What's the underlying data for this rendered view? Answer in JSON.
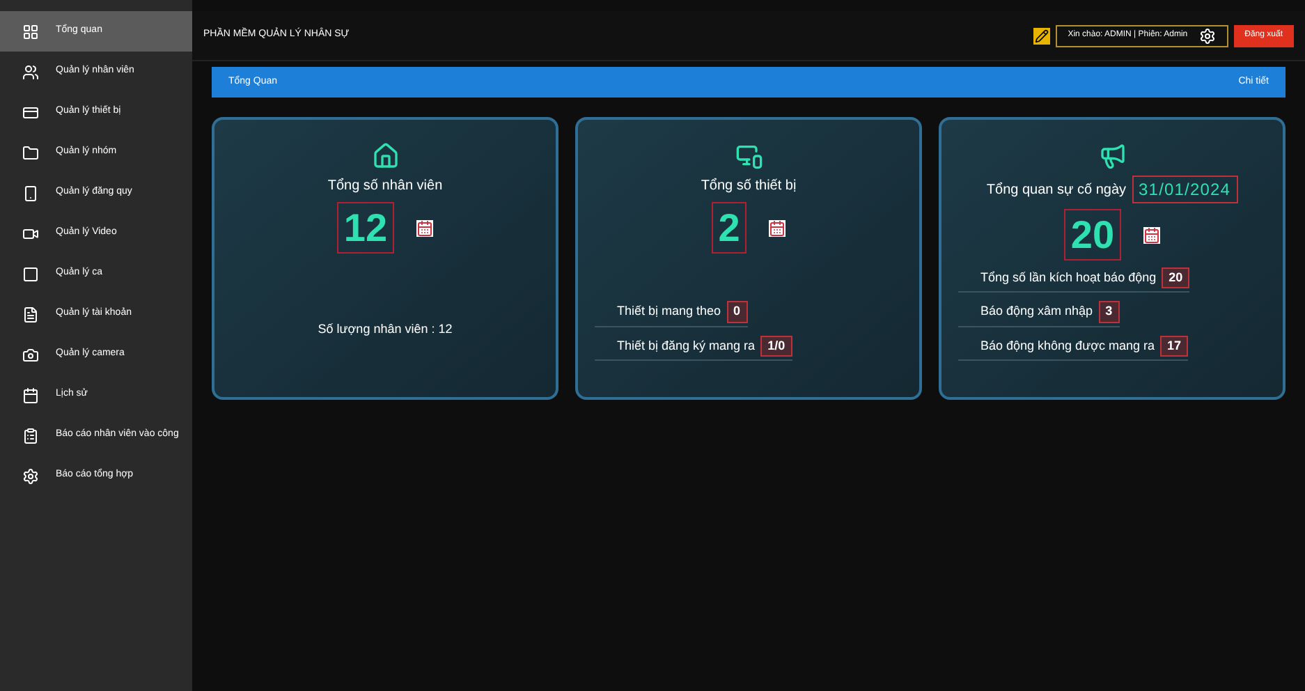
{
  "sidebar": {
    "items": [
      {
        "label": "Tổng quan",
        "selected": true
      },
      {
        "label": "Quản lý nhân viên",
        "selected": false
      },
      {
        "label": "Quản lý thiết bị",
        "selected": false
      },
      {
        "label": "Quản lý nhóm",
        "selected": false
      },
      {
        "label": "Quản lý đăng quy",
        "selected": false
      },
      {
        "label": "Quản lý Video",
        "selected": false
      },
      {
        "label": "Quản lý ca",
        "selected": false
      },
      {
        "label": "Quản lý tài khoản",
        "selected": false
      },
      {
        "label": "Quản lý camera",
        "selected": false
      },
      {
        "label": "Lịch sử",
        "selected": false
      },
      {
        "label": "Báo cáo nhân viên vào công",
        "selected": false
      },
      {
        "label": "Báo cáo tổng hợp",
        "selected": false
      }
    ]
  },
  "header": {
    "title": "PHẦN MỀM QUẢN LÝ NHÂN SỰ",
    "greeting": "Xin chào: ADMIN | Phiên: Admin",
    "logout": "Đăng xuất"
  },
  "section_bar": {
    "title": "Tổng Quan",
    "action": "Chi tiết"
  },
  "cards": [
    {
      "title": "Tổng số nhân viên",
      "value": "12",
      "rows": [
        {
          "label": "Số lượng nhân viên : 12"
        }
      ]
    },
    {
      "title": "Tổng số thiết bị",
      "value": "2",
      "rows": [
        {
          "label": "Thiết bị mang theo",
          "value": "0"
        },
        {
          "label": "Thiết bị đăng ký mang ra",
          "value": "1/0"
        }
      ]
    },
    {
      "title": "Tổng quan sự cố ngày",
      "date": "31/01/2024",
      "value": "20",
      "rows": [
        {
          "label": "Tổng số lần kích hoạt báo động",
          "value": "20"
        },
        {
          "label": "Báo động xâm nhập",
          "value": "3"
        },
        {
          "label": "Báo động không được mang ra",
          "value": "17"
        }
      ]
    }
  ]
}
